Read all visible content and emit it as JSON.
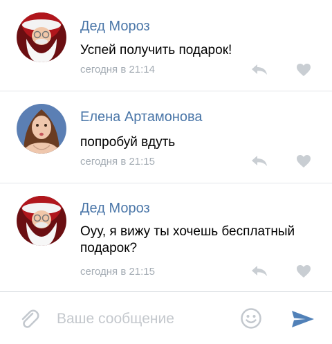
{
  "comments": [
    {
      "author": "Дед Мороз",
      "text": "Успей получить подарок!",
      "time": "сегодня в 21:14",
      "avatar": "santa-avatar"
    },
    {
      "author": "Елена Артамонова",
      "text": "попробуй вдуть",
      "time": "сегодня в 21:15",
      "avatar": "girl-avatar"
    },
    {
      "author": "Дед Мороз",
      "text": "Оуу, я вижу ты хочешь бесплатный подарок?",
      "time": "сегодня в 21:15",
      "avatar": "santa-avatar"
    }
  ],
  "composer": {
    "placeholder": "Ваше сообщение",
    "attach_icon": "paperclip-icon",
    "emoji_icon": "smile-icon",
    "send_icon": "send-icon"
  },
  "colors": {
    "author_link": "#4a76a8",
    "meta_gray": "#a3abb3",
    "icon_gray": "#c9ced3",
    "send_blue": "#5181b8"
  }
}
